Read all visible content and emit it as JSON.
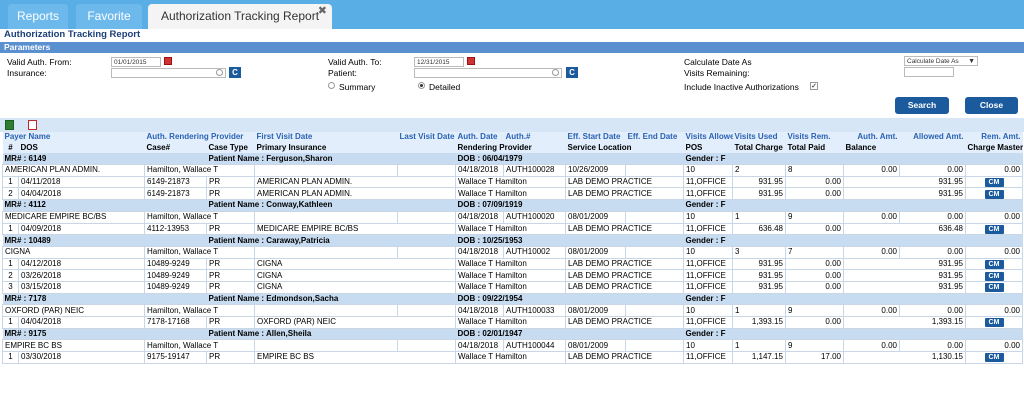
{
  "tabs": [
    "Reports",
    "Favorite",
    "Authorization Tracking Report"
  ],
  "tab_close": "✖",
  "title": "Authorization Tracking Report",
  "params": {
    "header": "Parameters",
    "valid_from_label": "Valid Auth. From:",
    "valid_from": "01/01/2015",
    "valid_to_label": "Valid Auth. To:",
    "valid_to": "12/31/2015",
    "insurance_label": "Insurance:",
    "patient_label": "Patient:",
    "c_button": "C",
    "summary_label": "Summary",
    "detailed_label": "Detailed",
    "calc_date_label": "Calculate Date As",
    "calc_date_value": "Calculate Date As",
    "visits_remaining_label": "Visits Remaining:",
    "include_inactive_label": "Include Inactive Authorizations",
    "search_button": "Search",
    "close_button": "Close"
  },
  "columns_row1": [
    "Payer Name",
    "Auth. Rendering Provider",
    "First Visit Date",
    "Last Visit Date",
    "Auth. Date",
    "Auth.#",
    "Eff. Start Date",
    "Eff. End Date",
    "Visits Allowed",
    "Visits Used",
    "Visits Rem.",
    "Auth. Amt.",
    "Allowed Amt.",
    "Rem. Amt."
  ],
  "columns_row2": [
    "#",
    "DOS",
    "Case#",
    "Case Type",
    "Primary Insurance",
    "Rendering Provider",
    "Service Location",
    "POS",
    "Total Charge",
    "Total Paid",
    "Balance",
    "Charge Master"
  ],
  "cm_label": "CM",
  "groups": [
    {
      "mr": "MR# : 6149",
      "patient": "Patient Name : Ferguson,Sharon",
      "dob": "DOB : 06/04/1979",
      "gender": "Gender : F",
      "summary": {
        "payer": "AMERICAN PLAN ADMIN.",
        "provider": "Hamilton, Wallace T",
        "first_visit": "",
        "last_visit": "",
        "auth_date": "04/18/2018",
        "auth_no": "AUTH100028",
        "eff_start": "10/26/2009",
        "eff_end": "",
        "allowed": "10",
        "used": "2",
        "rem": "8",
        "auth_amt": "0.00",
        "allowed_amt": "0.00",
        "rem_amt": "0.00"
      },
      "rows": [
        {
          "n": "1",
          "dos": "04/11/2018",
          "case": "6149-21873",
          "type": "PR",
          "ins": "AMERICAN PLAN ADMIN.",
          "prov": "Wallace T Hamilton",
          "loc": "LAB DEMO PRACTICE",
          "pos": "11,OFFICE",
          "charge": "931.95",
          "paid": "0.00",
          "bal": "931.95"
        },
        {
          "n": "2",
          "dos": "04/04/2018",
          "case": "6149-21873",
          "type": "PR",
          "ins": "AMERICAN PLAN ADMIN.",
          "prov": "Wallace T Hamilton",
          "loc": "LAB DEMO PRACTICE",
          "pos": "11,OFFICE",
          "charge": "931.95",
          "paid": "0.00",
          "bal": "931.95"
        }
      ]
    },
    {
      "mr": "MR# : 4112",
      "patient": "Patient Name : Conway,Kathleen",
      "dob": "DOB : 07/09/1919",
      "gender": "Gender : F",
      "summary": {
        "payer": "MEDICARE EMPIRE BC/BS",
        "provider": "Hamilton, Wallace T",
        "first_visit": "",
        "last_visit": "",
        "auth_date": "04/18/2018",
        "auth_no": "AUTH100020",
        "eff_start": "08/01/2009",
        "eff_end": "",
        "allowed": "10",
        "used": "1",
        "rem": "9",
        "auth_amt": "0.00",
        "allowed_amt": "0.00",
        "rem_amt": "0.00"
      },
      "rows": [
        {
          "n": "1",
          "dos": "04/09/2018",
          "case": "4112-13953",
          "type": "PR",
          "ins": "MEDICARE EMPIRE BC/BS",
          "prov": "Wallace T Hamilton",
          "loc": "LAB DEMO PRACTICE",
          "pos": "11,OFFICE",
          "charge": "636.48",
          "paid": "0.00",
          "bal": "636.48"
        }
      ]
    },
    {
      "mr": "MR# : 10489",
      "patient": "Patient Name : Caraway,Patricia",
      "dob": "DOB : 10/25/1953",
      "gender": "Gender : F",
      "summary": {
        "payer": "CIGNA",
        "provider": "Hamilton, Wallace T",
        "first_visit": "",
        "last_visit": "",
        "auth_date": "04/18/2018",
        "auth_no": "AUTH10002",
        "eff_start": "08/01/2009",
        "eff_end": "",
        "allowed": "10",
        "used": "3",
        "rem": "7",
        "auth_amt": "0.00",
        "allowed_amt": "0.00",
        "rem_amt": "0.00"
      },
      "rows": [
        {
          "n": "1",
          "dos": "04/12/2018",
          "case": "10489-9249",
          "type": "PR",
          "ins": "CIGNA",
          "prov": "Wallace T Hamilton",
          "loc": "LAB DEMO PRACTICE",
          "pos": "11,OFFICE",
          "charge": "931.95",
          "paid": "0.00",
          "bal": "931.95"
        },
        {
          "n": "2",
          "dos": "03/26/2018",
          "case": "10489-9249",
          "type": "PR",
          "ins": "CIGNA",
          "prov": "Wallace T Hamilton",
          "loc": "LAB DEMO PRACTICE",
          "pos": "11,OFFICE",
          "charge": "931.95",
          "paid": "0.00",
          "bal": "931.95"
        },
        {
          "n": "3",
          "dos": "03/15/2018",
          "case": "10489-9249",
          "type": "PR",
          "ins": "CIGNA",
          "prov": "Wallace T Hamilton",
          "loc": "LAB DEMO PRACTICE",
          "pos": "11,OFFICE",
          "charge": "931.95",
          "paid": "0.00",
          "bal": "931.95"
        }
      ]
    },
    {
      "mr": "MR# : 7178",
      "patient": "Patient Name : Edmondson,Sacha",
      "dob": "DOB : 09/22/1954",
      "gender": "Gender : F",
      "summary": {
        "payer": "OXFORD (PAR) NEIC",
        "provider": "Hamilton, Wallace T",
        "first_visit": "",
        "last_visit": "",
        "auth_date": "04/18/2018",
        "auth_no": "AUTH100033",
        "eff_start": "08/01/2009",
        "eff_end": "",
        "allowed": "10",
        "used": "1",
        "rem": "9",
        "auth_amt": "0.00",
        "allowed_amt": "0.00",
        "rem_amt": "0.00"
      },
      "rows": [
        {
          "n": "1",
          "dos": "04/04/2018",
          "case": "7178-17168",
          "type": "PR",
          "ins": "OXFORD (PAR) NEIC",
          "prov": "Wallace T Hamilton",
          "loc": "LAB DEMO PRACTICE",
          "pos": "11,OFFICE",
          "charge": "1,393.15",
          "paid": "0.00",
          "bal": "1,393.15"
        }
      ]
    },
    {
      "mr": "MR# : 9175",
      "patient": "Patient Name : Allen,Sheila",
      "dob": "DOB : 02/01/1947",
      "gender": "Gender : F",
      "summary": {
        "payer": "EMPIRE BC BS",
        "provider": "Hamilton, Wallace T",
        "first_visit": "",
        "last_visit": "",
        "auth_date": "04/18/2018",
        "auth_no": "AUTH100044",
        "eff_start": "08/01/2009",
        "eff_end": "",
        "allowed": "10",
        "used": "1",
        "rem": "9",
        "auth_amt": "0.00",
        "allowed_amt": "0.00",
        "rem_amt": "0.00"
      },
      "rows": [
        {
          "n": "1",
          "dos": "03/30/2018",
          "case": "9175-19147",
          "type": "PR",
          "ins": "EMPIRE BC BS",
          "prov": "Wallace T Hamilton",
          "loc": "LAB DEMO PRACTICE",
          "pos": "11,OFFICE",
          "charge": "1,147.15",
          "paid": "17.00",
          "bal": "1,130.15"
        }
      ]
    }
  ]
}
